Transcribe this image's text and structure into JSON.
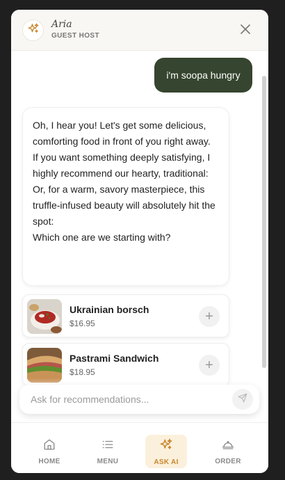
{
  "header": {
    "host_name": "Aria",
    "host_role": "GUEST HOST"
  },
  "chat": {
    "user_message": "i'm soopa hungry",
    "ai_message": [
      "Oh, I hear you! Let's get some delicious, comforting food in front of you right away.",
      "If you want something deeply satisfying, I highly recommend our hearty, traditional:",
      "Or, for a warm, savory masterpiece, this truffle-infused beauty will absolutely hit the spot:",
      "Which one are we starting with?"
    ],
    "products": [
      {
        "name": "Ukrainian borsch",
        "price": "$16.95"
      },
      {
        "name": "Pastrami Sandwich",
        "price": "$18.95"
      }
    ]
  },
  "input": {
    "placeholder": "Ask for recommendations..."
  },
  "nav": {
    "items": [
      {
        "label": "HOME",
        "icon": "home-icon"
      },
      {
        "label": "MENU",
        "icon": "menu-list-icon"
      },
      {
        "label": "ASK AI",
        "icon": "sparkle-icon",
        "active": true
      },
      {
        "label": "ORDER",
        "icon": "cloche-icon"
      }
    ]
  },
  "colors": {
    "user_bubble": "#36452f",
    "accent": "#c8862d",
    "accent_bg": "#fbf0dc"
  }
}
